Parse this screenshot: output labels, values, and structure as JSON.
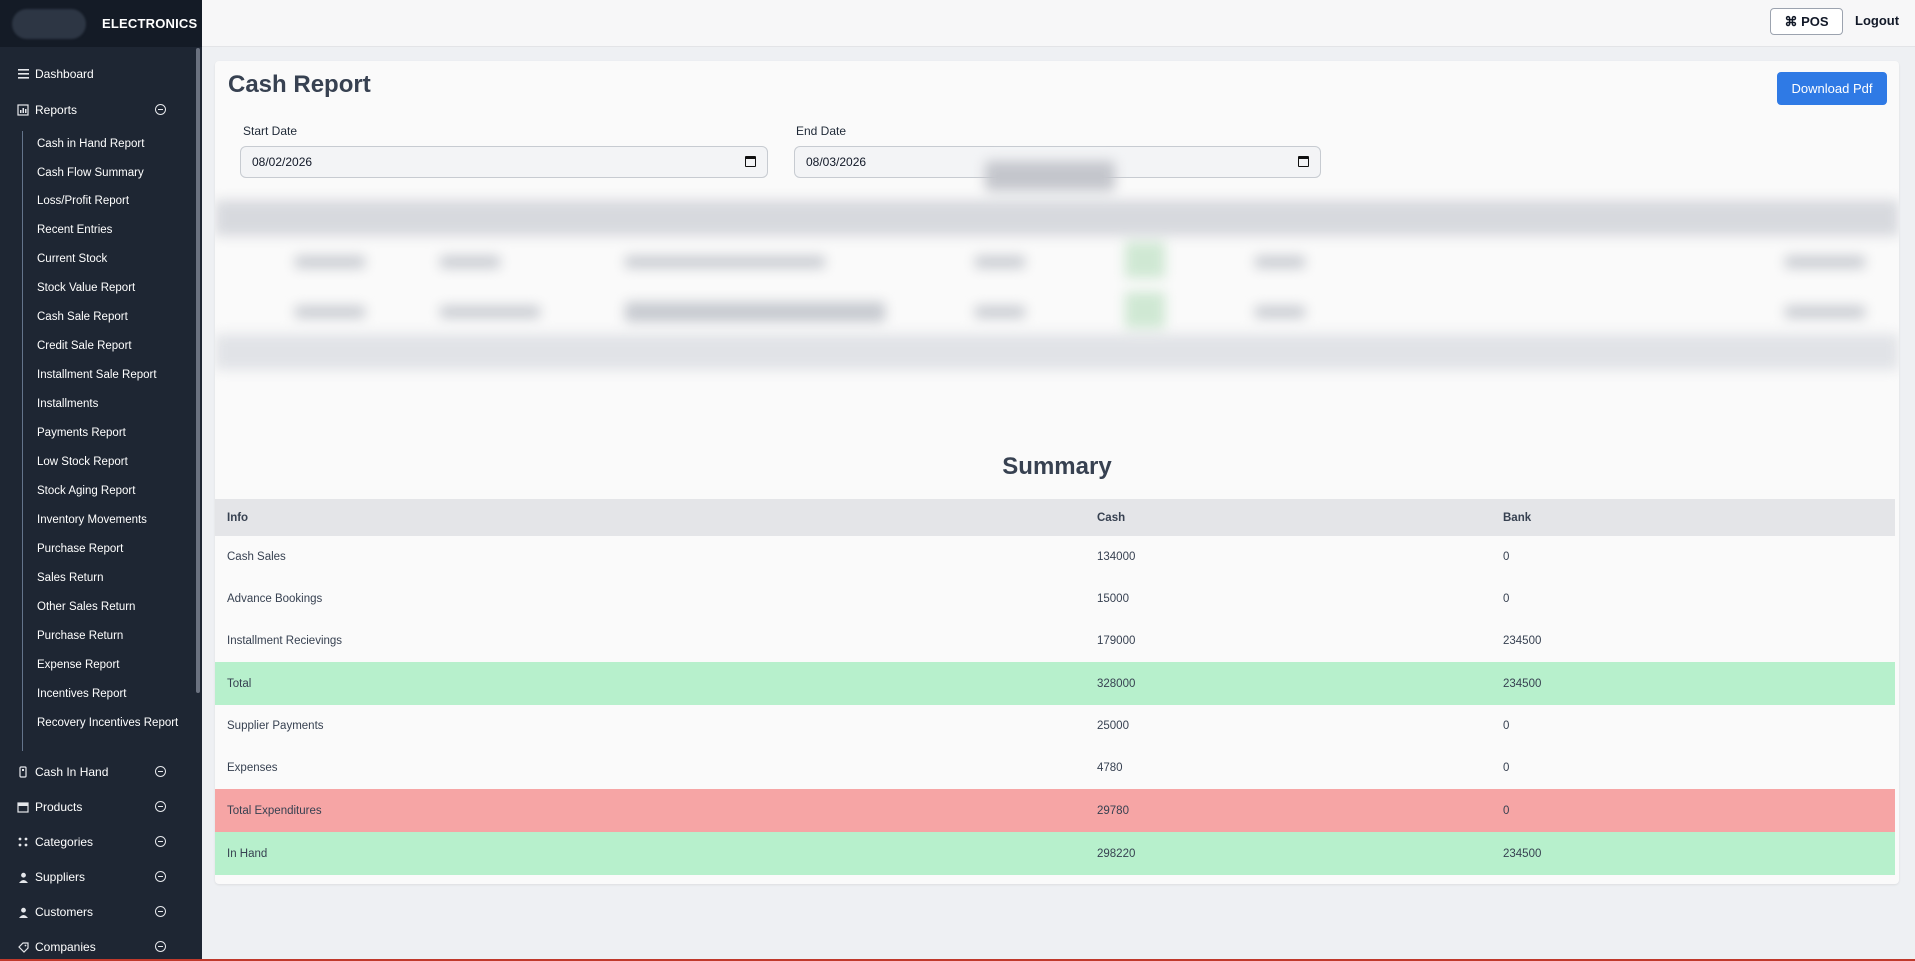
{
  "sidebar": {
    "brand": "ELECTRONICS",
    "top_items": [
      {
        "label": "Dashboard",
        "icon": "menu-icon"
      },
      {
        "label": "Reports",
        "icon": "report-icon"
      }
    ],
    "report_items": [
      "Cash in Hand Report",
      "Cash Flow Summary",
      "Loss/Profit Report",
      "Recent Entries",
      "Current Stock",
      "Stock Value Report",
      "Cash Sale Report",
      "Credit Sale Report",
      "Installment Sale Report",
      "Installments",
      "Payments Report",
      "Low Stock Report",
      "Stock Aging Report",
      "Inventory Movements",
      "Purchase Report",
      "Sales Return",
      "Other Sales Return",
      "Purchase Return",
      "Expense Report",
      "Incentives Report",
      "Recovery Incentives Report"
    ],
    "bottom_items": [
      {
        "label": "Cash In Hand",
        "icon": "cash-icon"
      },
      {
        "label": "Products",
        "icon": "store-icon"
      },
      {
        "label": "Categories",
        "icon": "grid-icon"
      },
      {
        "label": "Suppliers",
        "icon": "user-icon"
      },
      {
        "label": "Customers",
        "icon": "customer-icon"
      },
      {
        "label": "Companies",
        "icon": "tag-icon"
      }
    ]
  },
  "topbar": {
    "pos_label": "⌘ POS",
    "logout_label": "Logout"
  },
  "page": {
    "title": "Cash Report",
    "download_label": "Download Pdf",
    "start_date_label": "Start Date",
    "start_date_value": "08/02/2026",
    "end_date_label": "End Date",
    "end_date_value": "08/03/2026"
  },
  "summary": {
    "title": "Summary",
    "headers": [
      "Info",
      "Cash",
      "Bank"
    ],
    "rows": [
      {
        "info": "Cash Sales",
        "cash": "134000",
        "bank": "0",
        "style": "norm"
      },
      {
        "info": "Advance Bookings",
        "cash": "15000",
        "bank": "0",
        "style": "norm"
      },
      {
        "info": "Installment Recievings",
        "cash": "179000",
        "bank": "234500",
        "style": "norm"
      },
      {
        "info": "Total",
        "cash": "328000",
        "bank": "234500",
        "style": "green"
      },
      {
        "info": "Supplier Payments",
        "cash": "25000",
        "bank": "0",
        "style": "norm"
      },
      {
        "info": "Expenses",
        "cash": "4780",
        "bank": "0",
        "style": "norm"
      },
      {
        "info": "Total Expenditures",
        "cash": "29780",
        "bank": "0",
        "style": "red"
      },
      {
        "info": "In Hand",
        "cash": "298220",
        "bank": "234500",
        "style": "green"
      }
    ]
  },
  "colors": {
    "sidebar_bg": "#1e2633",
    "accent": "#2f7ae5",
    "positive_row": "#b7f0cc",
    "negative_row": "#f6a5a5"
  }
}
